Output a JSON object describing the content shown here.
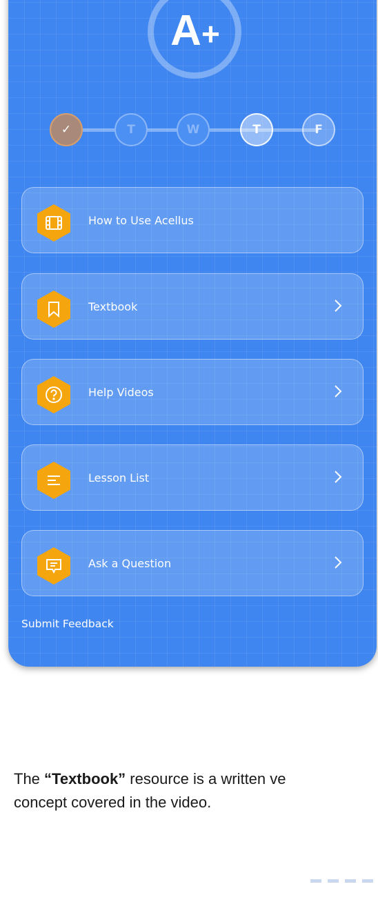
{
  "grade": {
    "letter": "A",
    "modifier": "+"
  },
  "week_days": [
    {
      "label": "✓",
      "state": "done"
    },
    {
      "label": "T",
      "state": "inactive"
    },
    {
      "label": "W",
      "state": "inactive"
    },
    {
      "label": "T",
      "state": "current"
    },
    {
      "label": "F",
      "state": "future"
    }
  ],
  "menu": [
    {
      "label": "How to Use Acellus",
      "icon": "film-icon",
      "has_chevron": false
    },
    {
      "label": "Textbook",
      "icon": "bookmark-icon",
      "has_chevron": true
    },
    {
      "label": "Help Videos",
      "icon": "question-circle-icon",
      "has_chevron": true
    },
    {
      "label": "Lesson List",
      "icon": "list-lines-icon",
      "has_chevron": true
    },
    {
      "label": "Ask a Question",
      "icon": "chat-bubble-icon",
      "has_chevron": true
    }
  ],
  "footer": {
    "feedback_label": "Submit Feedback"
  },
  "caption": {
    "prefix": "The ",
    "highlight": "“Textbook”",
    "rest_line1": " resource is a written ve",
    "line2": "concept covered in the video."
  },
  "colors": {
    "panel": "#3f86f0",
    "hex_accent": "#f5a50e",
    "done_day": "#a98a7a"
  }
}
